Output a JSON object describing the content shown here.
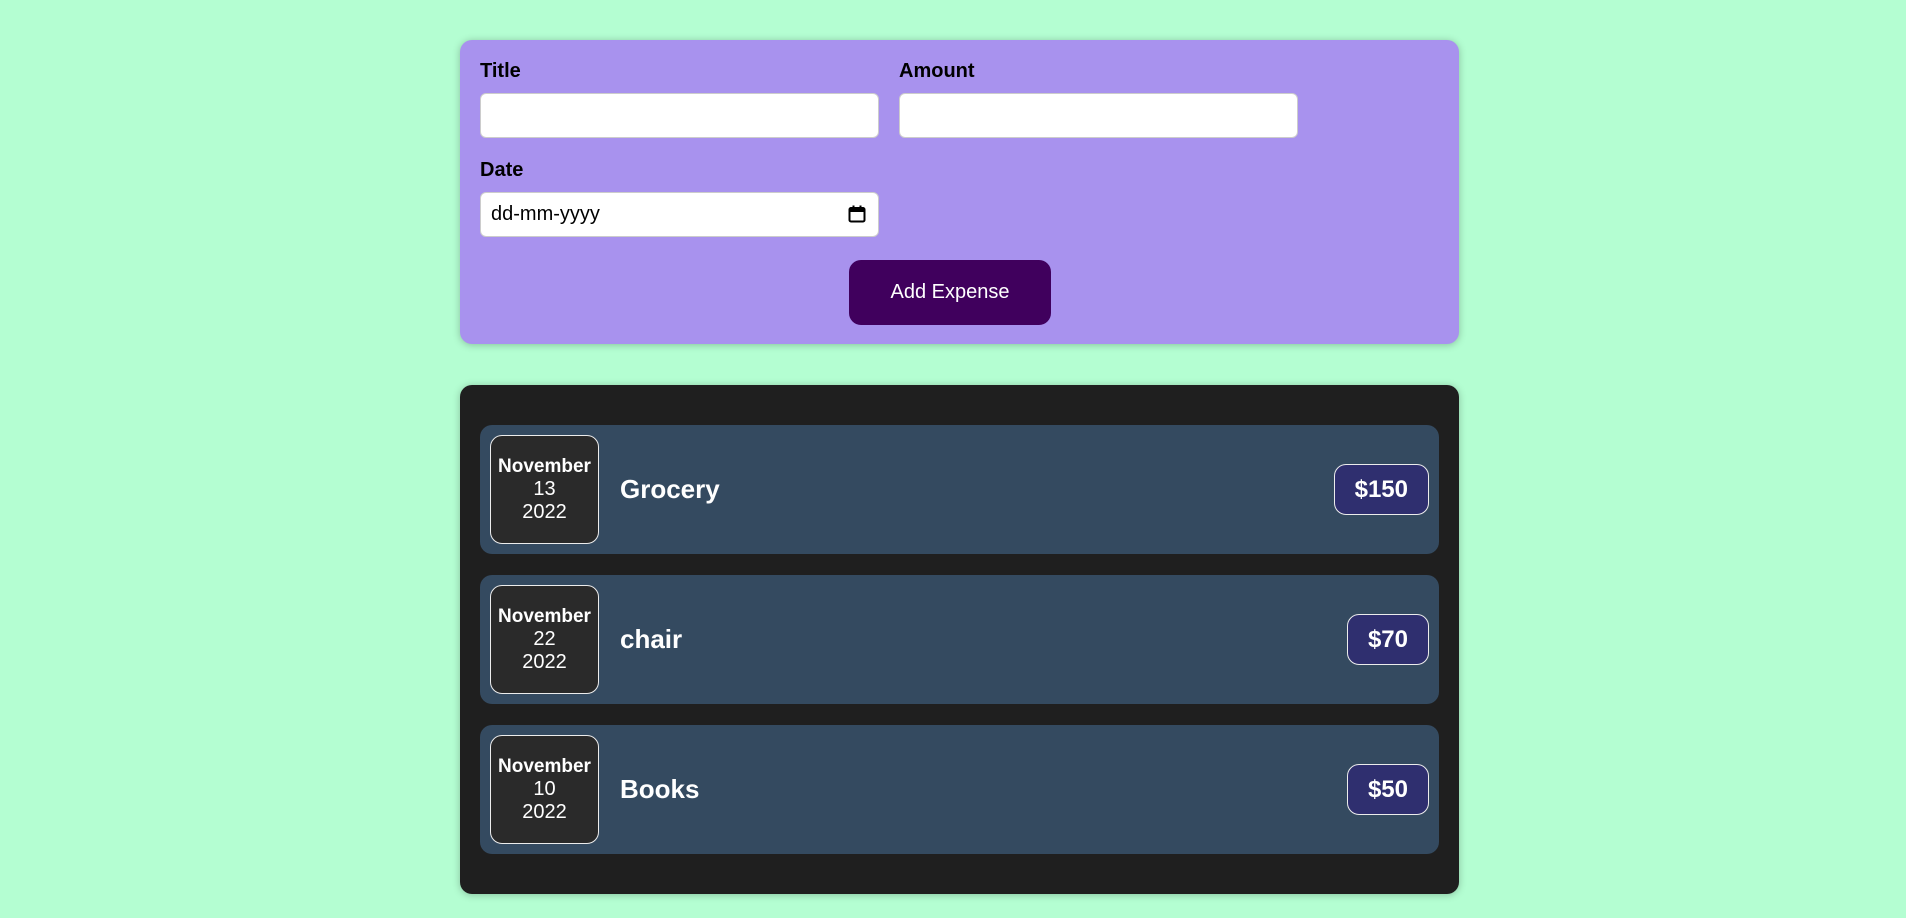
{
  "form": {
    "title_label": "Title",
    "title_value": "",
    "amount_label": "Amount",
    "amount_value": "",
    "date_label": "Date",
    "date_placeholder": "dd-mm-yyyy",
    "submit_label": "Add Expense"
  },
  "expenses": [
    {
      "month": "November",
      "day": "13",
      "year": "2022",
      "title": "Grocery",
      "amount": "$150"
    },
    {
      "month": "November",
      "day": "22",
      "year": "2022",
      "title": "chair",
      "amount": "$70"
    },
    {
      "month": "November",
      "day": "10",
      "year": "2022",
      "title": "Books",
      "amount": "$50"
    }
  ],
  "colors": {
    "page_background": "#b4fed2",
    "form_background": "#a892ee",
    "button_background": "#40005d",
    "list_background": "#1f1f1f",
    "item_background": "#344a60",
    "price_background": "#2f2f6f"
  },
  "icons": {
    "date_picker": "calendar-icon"
  }
}
